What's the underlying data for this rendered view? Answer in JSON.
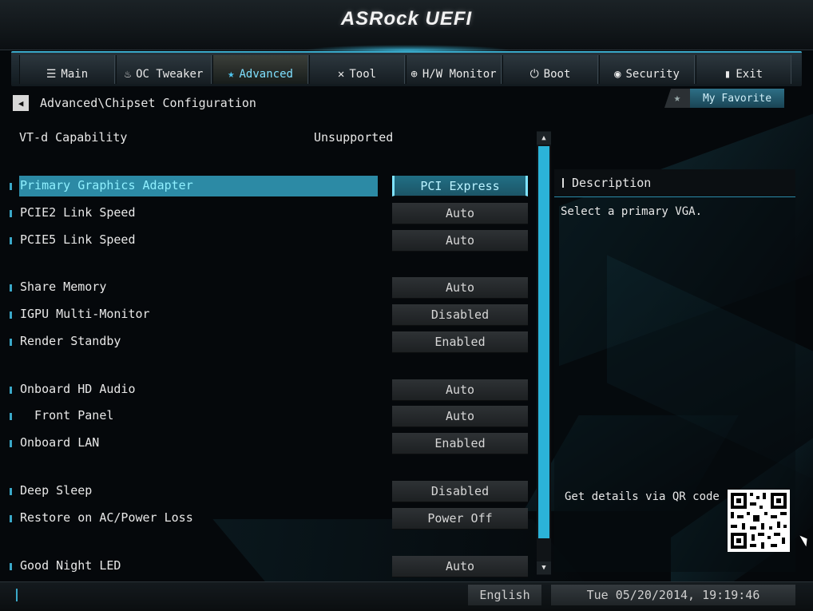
{
  "app": {
    "title": "ASRock UEFI"
  },
  "tabs": [
    {
      "label": "Main",
      "icon": "list-icon",
      "glyph": "☰",
      "active": false
    },
    {
      "label": "OC Tweaker",
      "icon": "flame-icon",
      "glyph": "♨",
      "active": false
    },
    {
      "label": "Advanced",
      "icon": "star-icon",
      "glyph": "★",
      "active": true
    },
    {
      "label": "Tool",
      "icon": "tools-icon",
      "glyph": "✕",
      "active": false
    },
    {
      "label": "H/W Monitor",
      "icon": "monitor-icon",
      "glyph": "⊕",
      "active": false
    },
    {
      "label": "Boot",
      "icon": "power-icon",
      "glyph": "⏻",
      "active": false
    },
    {
      "label": "Security",
      "icon": "shield-icon",
      "glyph": "◉",
      "active": false
    },
    {
      "label": "Exit",
      "icon": "exit-icon",
      "glyph": "▮",
      "active": false
    }
  ],
  "breadcrumb": {
    "path": "Advanced\\Chipset Configuration",
    "back_glyph": "◀"
  },
  "favorite": {
    "label": "My Favorite",
    "glyph": "★"
  },
  "static_info": {
    "label": "VT-d Capability",
    "value": "Unsupported"
  },
  "settings": [
    {
      "label": "Primary Graphics Adapter",
      "value": "PCI Express",
      "selected": true
    },
    {
      "label": "PCIE2 Link Speed",
      "value": "Auto"
    },
    {
      "label": "PCIE5 Link Speed",
      "value": "Auto"
    },
    {
      "label": "Share Memory",
      "value": "Auto"
    },
    {
      "label": "IGPU Multi-Monitor",
      "value": "Disabled"
    },
    {
      "label": "Render Standby",
      "value": "Enabled"
    },
    {
      "label": "Onboard HD Audio",
      "value": "Auto"
    },
    {
      "label": "  Front Panel",
      "value": "Auto"
    },
    {
      "label": "Onboard LAN",
      "value": "Enabled"
    },
    {
      "label": "Deep Sleep",
      "value": "Disabled"
    },
    {
      "label": "Restore on AC/Power Loss",
      "value": "Power Off"
    },
    {
      "label": "Good Night LED",
      "value": "Auto"
    }
  ],
  "description": {
    "title": "Description",
    "text": "Select a primary VGA.",
    "qr_text": "Get details via QR code"
  },
  "footer": {
    "language": "English",
    "datetime": "Tue 05/20/2014, 19:19:46"
  },
  "colors": {
    "accent": "#2bb3d8",
    "selected_row": "#2c8aa5",
    "background": "#05080b"
  }
}
